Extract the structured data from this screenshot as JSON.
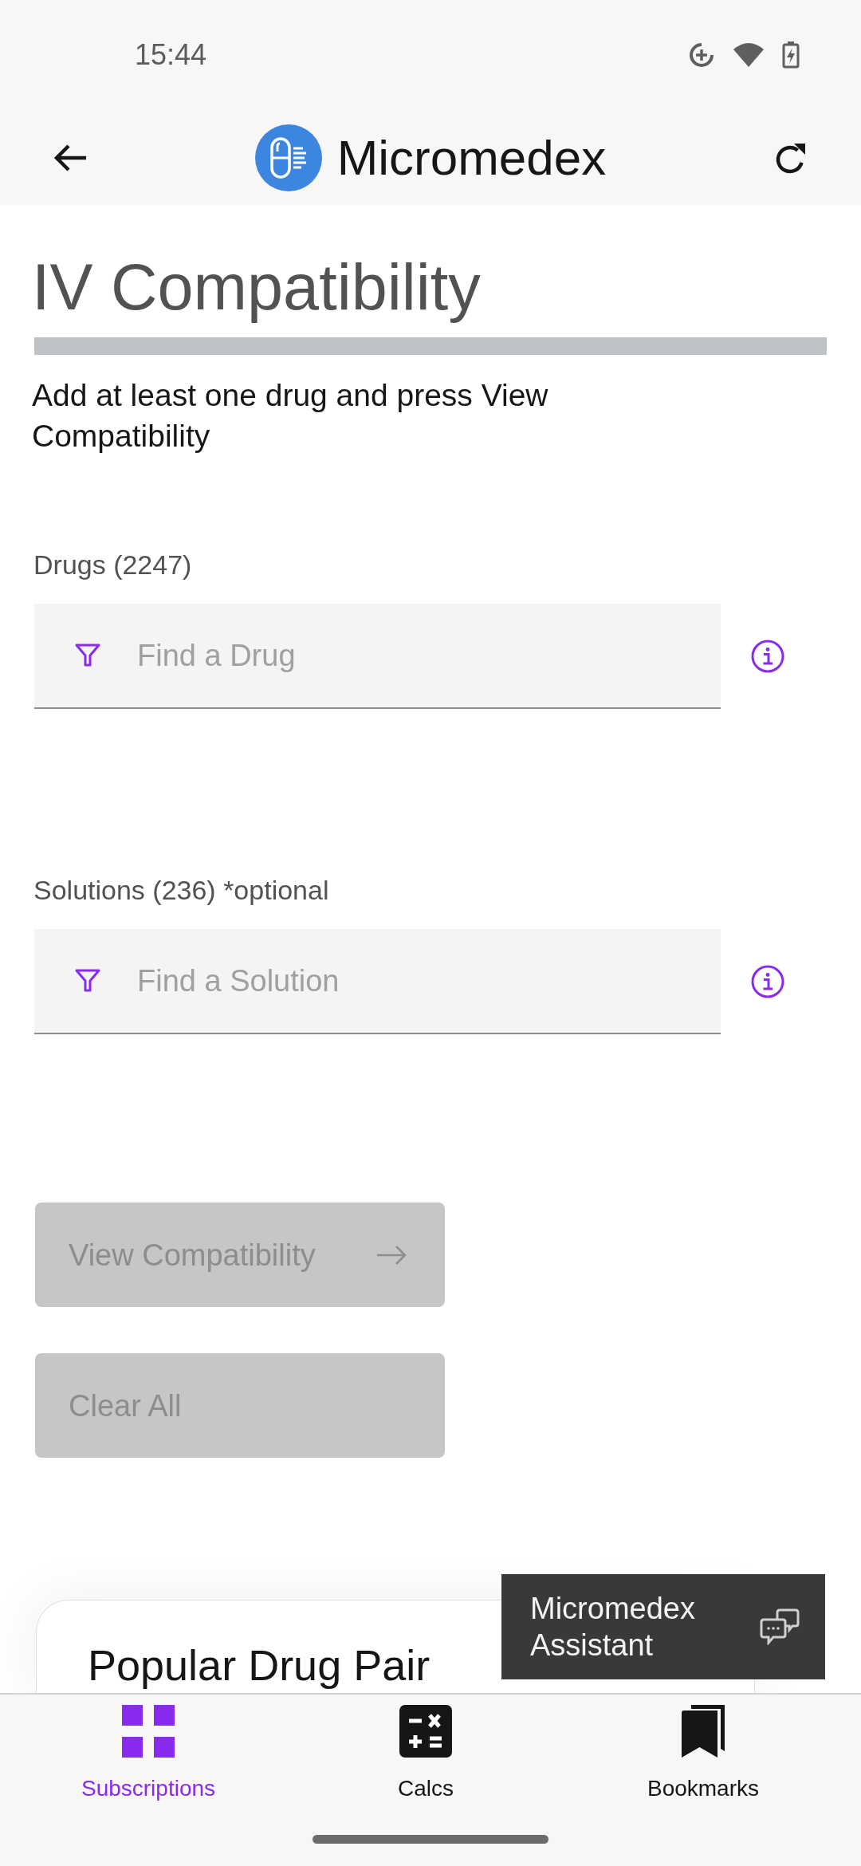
{
  "status_bar": {
    "time": "15:44"
  },
  "app_bar": {
    "title": "Micromedex"
  },
  "page": {
    "title": "IV Compatibility",
    "instructions": "Add at least one drug and press View Compatibility"
  },
  "fields": [
    {
      "label": "Drugs (2247)",
      "placeholder": "Find a Drug"
    },
    {
      "label": "Solutions (236) *optional",
      "placeholder": "Find a Solution"
    }
  ],
  "buttons": [
    {
      "label": "View Compatibility",
      "disabled": true,
      "kind": "arrow"
    },
    {
      "label": "Clear All",
      "disabled": true,
      "kind": "plain"
    }
  ],
  "card": {
    "title": "Popular Drug Pair"
  },
  "assistant": {
    "label": "Micromedex Assistant"
  },
  "bottom_nav": [
    {
      "label": "Subscriptions",
      "selected": true,
      "kind": "grid"
    },
    {
      "label": "Calcs",
      "selected": false,
      "kind": "calculator"
    },
    {
      "label": "Bookmarks",
      "selected": false,
      "kind": "bookmarks"
    }
  ]
}
